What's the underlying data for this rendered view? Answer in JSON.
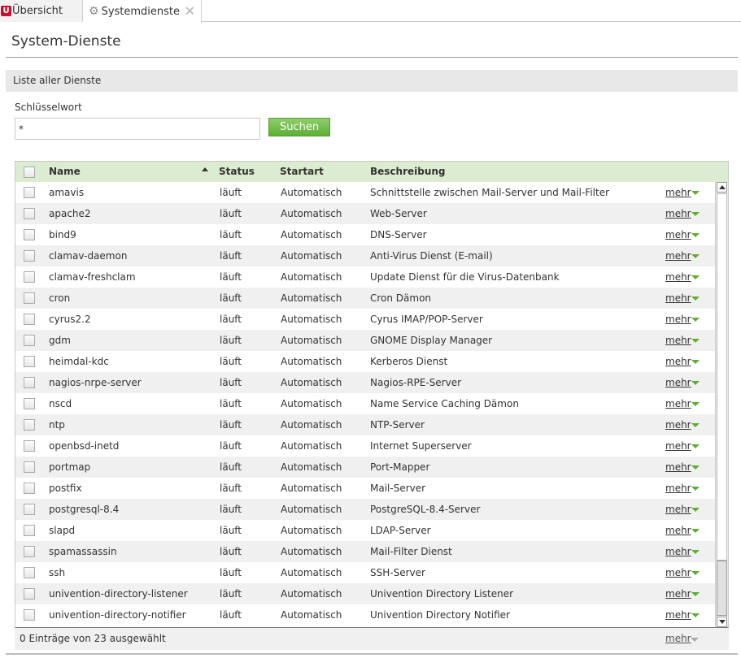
{
  "tabs": [
    {
      "label": "Übersicht",
      "icon": "univention-logo-icon"
    },
    {
      "label": "Systemdienste",
      "icon": "gear-icon",
      "close": "✕"
    }
  ],
  "logo_letter": "U",
  "page_title": "System-Dienste",
  "section_title": "Liste aller Dienste",
  "search": {
    "label": "Schlüsselwort",
    "value": "*",
    "button": "Suchen"
  },
  "columns": {
    "name": "Name",
    "status": "Status",
    "start": "Startart",
    "desc": "Beschreibung"
  },
  "more_label": "mehr",
  "services": [
    {
      "name": "amavis",
      "status": "läuft",
      "start": "Automatisch",
      "desc": "Schnittstelle zwischen Mail-Server und Mail-Filter"
    },
    {
      "name": "apache2",
      "status": "läuft",
      "start": "Automatisch",
      "desc": "Web-Server"
    },
    {
      "name": "bind9",
      "status": "läuft",
      "start": "Automatisch",
      "desc": "DNS-Server"
    },
    {
      "name": "clamav-daemon",
      "status": "läuft",
      "start": "Automatisch",
      "desc": "Anti-Virus Dienst (E-mail)"
    },
    {
      "name": "clamav-freshclam",
      "status": "läuft",
      "start": "Automatisch",
      "desc": "Update Dienst für die Virus-Datenbank"
    },
    {
      "name": "cron",
      "status": "läuft",
      "start": "Automatisch",
      "desc": "Cron Dämon"
    },
    {
      "name": "cyrus2.2",
      "status": "läuft",
      "start": "Automatisch",
      "desc": "Cyrus IMAP/POP-Server"
    },
    {
      "name": "gdm",
      "status": "läuft",
      "start": "Automatisch",
      "desc": "GNOME Display Manager"
    },
    {
      "name": "heimdal-kdc",
      "status": "läuft",
      "start": "Automatisch",
      "desc": "Kerberos Dienst"
    },
    {
      "name": "nagios-nrpe-server",
      "status": "läuft",
      "start": "Automatisch",
      "desc": "Nagios-RPE-Server"
    },
    {
      "name": "nscd",
      "status": "läuft",
      "start": "Automatisch",
      "desc": "Name Service Caching Dämon"
    },
    {
      "name": "ntp",
      "status": "läuft",
      "start": "Automatisch",
      "desc": "NTP-Server"
    },
    {
      "name": "openbsd-inetd",
      "status": "läuft",
      "start": "Automatisch",
      "desc": "Internet Superserver"
    },
    {
      "name": "portmap",
      "status": "läuft",
      "start": "Automatisch",
      "desc": "Port-Mapper"
    },
    {
      "name": "postfix",
      "status": "läuft",
      "start": "Automatisch",
      "desc": "Mail-Server"
    },
    {
      "name": "postgresql-8.4",
      "status": "läuft",
      "start": "Automatisch",
      "desc": "PostgreSQL-8.4-Server"
    },
    {
      "name": "slapd",
      "status": "läuft",
      "start": "Automatisch",
      "desc": "LDAP-Server"
    },
    {
      "name": "spamassassin",
      "status": "läuft",
      "start": "Automatisch",
      "desc": "Mail-Filter Dienst"
    },
    {
      "name": "ssh",
      "status": "läuft",
      "start": "Automatisch",
      "desc": "SSH-Server"
    },
    {
      "name": "univention-directory-listener",
      "status": "läuft",
      "start": "Automatisch",
      "desc": "Univention Directory Listener"
    },
    {
      "name": "univention-directory-notifier",
      "status": "läuft",
      "start": "Automatisch",
      "desc": "Univention Directory Notifier"
    }
  ],
  "footer": {
    "text": "0 Einträge von 23 ausgewählt",
    "more": "mehr"
  },
  "colors": {
    "accent_green": "#5fae38",
    "header_green": "#dcecd0",
    "logo_red": "#c8102e"
  }
}
